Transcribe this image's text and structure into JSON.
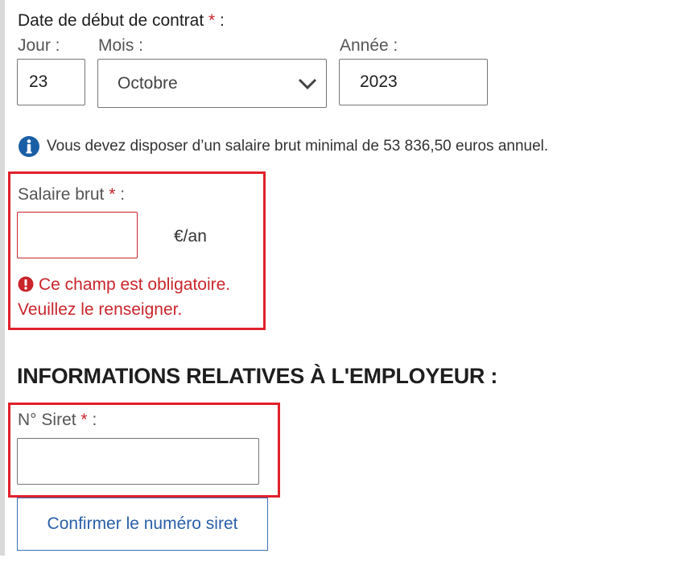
{
  "contract_start": {
    "label": "Date de début de contrat",
    "required_mark": "*",
    "suffix": " :",
    "day": {
      "label": "Jour :",
      "value": "23"
    },
    "month": {
      "label": "Mois :",
      "value": "Octobre"
    },
    "year": {
      "label": "Année :",
      "value": "2023"
    }
  },
  "info": {
    "text": "Vous devez disposer d’un salaire brut minimal de 53 836,50  euros annuel.",
    "icon": "info-icon"
  },
  "salary": {
    "label": "Salaire brut",
    "required_mark": "*",
    "suffix": " :",
    "value": "",
    "unit": "€/an",
    "error_line1": "Ce champ est obligatoire.",
    "error_line2": "Veuillez le renseigner.",
    "error_icon": "exclamation-circle-icon"
  },
  "employer": {
    "section_title": "INFORMATIONS RELATIVES À L'EMPLOYEUR :",
    "siret_label": "N° Siret",
    "required_mark": "*",
    "suffix": " :",
    "siret_value": "",
    "confirm_button": "Confirmer le numéro siret"
  },
  "colors": {
    "required": "#c9252b",
    "highlight_border": "#e0212b",
    "link_blue": "#2a5fa8",
    "info_blue": "#1a5fa6"
  }
}
